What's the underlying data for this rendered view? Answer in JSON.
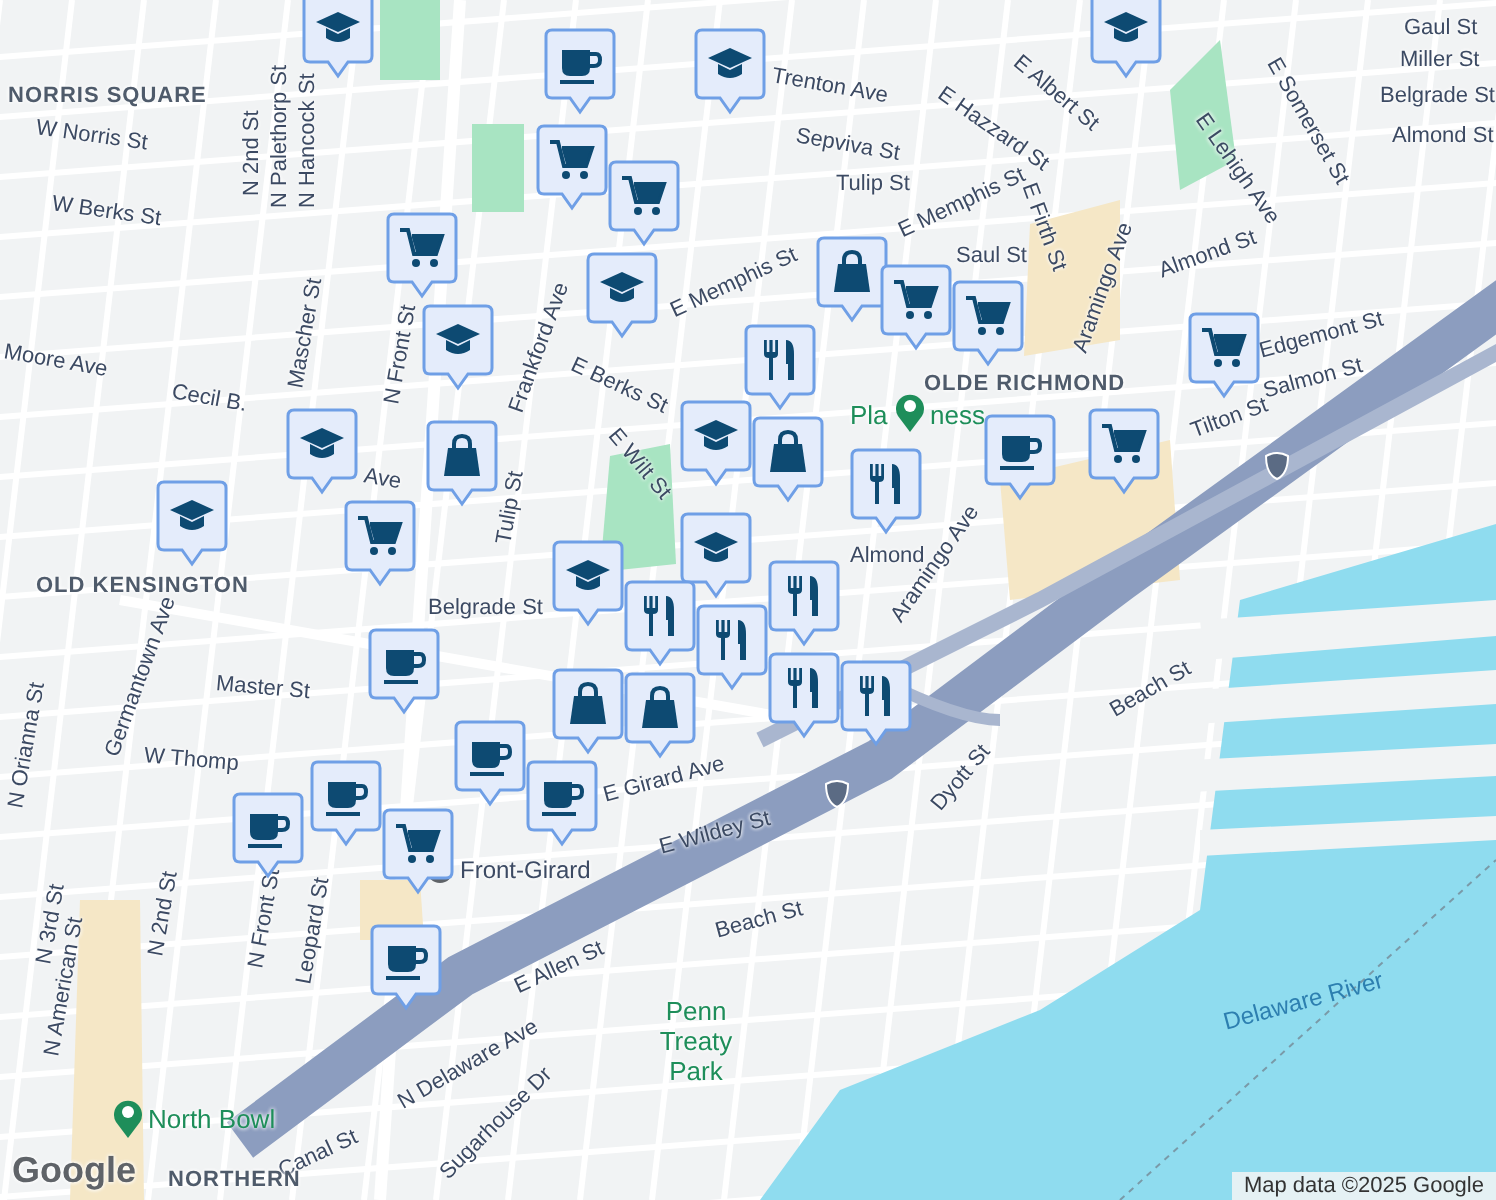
{
  "map": {
    "labels": [
      {
        "kind": "area",
        "text": "NORRIS SQUARE"
      },
      {
        "kind": "street",
        "text": "W Norris St"
      },
      {
        "kind": "street",
        "text": "W Berks St"
      },
      {
        "kind": "street",
        "text": "N 2nd St"
      },
      {
        "kind": "street",
        "text": "N Palethorp St"
      },
      {
        "kind": "street",
        "text": "N Hancock St"
      },
      {
        "kind": "street",
        "text": "Moore Ave"
      },
      {
        "kind": "street",
        "text": "Cecil B."
      },
      {
        "kind": "street",
        "text": "Ave"
      },
      {
        "kind": "street",
        "text": "Mascher St"
      },
      {
        "kind": "street",
        "text": "N Front St"
      },
      {
        "kind": "street",
        "text": "Frankford Ave"
      },
      {
        "kind": "street",
        "text": "Tulip St"
      },
      {
        "kind": "street",
        "text": "E Berks St"
      },
      {
        "kind": "street",
        "text": "E Wilt St"
      },
      {
        "kind": "street",
        "text": "E Memphis St"
      },
      {
        "kind": "street",
        "text": "Trenton Ave"
      },
      {
        "kind": "street",
        "text": "Sepviva St"
      },
      {
        "kind": "street",
        "text": "Tulip St"
      },
      {
        "kind": "street",
        "text": "E Memphis St"
      },
      {
        "kind": "street",
        "text": "E Hazzard St"
      },
      {
        "kind": "street",
        "text": "E Firth St"
      },
      {
        "kind": "street",
        "text": "E Albert St"
      },
      {
        "kind": "street",
        "text": "Saul St"
      },
      {
        "kind": "street",
        "text": "Almond St"
      },
      {
        "kind": "street",
        "text": "E Lehigh Ave"
      },
      {
        "kind": "street",
        "text": "E Somerset St"
      },
      {
        "kind": "street",
        "text": "Gaul St"
      },
      {
        "kind": "street",
        "text": "Miller St"
      },
      {
        "kind": "street",
        "text": "Belgrade St"
      },
      {
        "kind": "street",
        "text": "Almond St"
      },
      {
        "kind": "street",
        "text": "Aramingo Ave"
      },
      {
        "kind": "street",
        "text": "Edgemont St"
      },
      {
        "kind": "street",
        "text": "Salmon St"
      },
      {
        "kind": "street",
        "text": "Tilton St"
      },
      {
        "kind": "street",
        "text": "Almond"
      },
      {
        "kind": "area",
        "text": "OLDE RICHMOND"
      },
      {
        "kind": "place",
        "text": "Pla"
      },
      {
        "kind": "place",
        "text": "ness"
      },
      {
        "kind": "area",
        "text": "OLD KENSINGTON"
      },
      {
        "kind": "street",
        "text": "Aramingo Ave"
      },
      {
        "kind": "street",
        "text": "Belgrade St"
      },
      {
        "kind": "street",
        "text": "Master St"
      },
      {
        "kind": "street",
        "text": "W Thomp"
      },
      {
        "kind": "street",
        "text": "Germantown Ave"
      },
      {
        "kind": "street",
        "text": "N Orianna St"
      },
      {
        "kind": "street",
        "text": "E Girard Ave"
      },
      {
        "kind": "street",
        "text": "E Wildey St"
      },
      {
        "kind": "street",
        "text": "Beach St"
      },
      {
        "kind": "street",
        "text": "Dyott St"
      },
      {
        "kind": "station",
        "text": "Front-Girard"
      },
      {
        "kind": "street",
        "text": "N Front St"
      },
      {
        "kind": "street",
        "text": "Leopard St"
      },
      {
        "kind": "street",
        "text": "N 2nd St"
      },
      {
        "kind": "street",
        "text": "N 3rd St"
      },
      {
        "kind": "street",
        "text": "N American St"
      },
      {
        "kind": "street",
        "text": "Beach St"
      },
      {
        "kind": "street",
        "text": "E Allen St"
      },
      {
        "kind": "park",
        "text": "Penn Treaty Park"
      },
      {
        "kind": "water",
        "text": "Delaware River"
      },
      {
        "kind": "street",
        "text": "N Delaware Ave"
      },
      {
        "kind": "street",
        "text": "Sugarhouse Dr"
      },
      {
        "kind": "street",
        "text": "Canal St"
      },
      {
        "kind": "place",
        "text": "North Bowl"
      },
      {
        "kind": "area",
        "text": "NORTHERN"
      }
    ],
    "markers": [
      {
        "kind": "school"
      },
      {
        "kind": "school"
      },
      {
        "kind": "coffee"
      },
      {
        "kind": "school"
      },
      {
        "kind": "cart"
      },
      {
        "kind": "cart"
      },
      {
        "kind": "cart"
      },
      {
        "kind": "school"
      },
      {
        "kind": "bag"
      },
      {
        "kind": "cart"
      },
      {
        "kind": "cart"
      },
      {
        "kind": "school"
      },
      {
        "kind": "restaurant"
      },
      {
        "kind": "school"
      },
      {
        "kind": "bag"
      },
      {
        "kind": "restaurant"
      },
      {
        "kind": "coffee"
      },
      {
        "kind": "cart"
      },
      {
        "kind": "cart"
      },
      {
        "kind": "school"
      },
      {
        "kind": "bag"
      },
      {
        "kind": "cart"
      },
      {
        "kind": "school"
      },
      {
        "kind": "school"
      },
      {
        "kind": "school"
      },
      {
        "kind": "restaurant"
      },
      {
        "kind": "restaurant"
      },
      {
        "kind": "restaurant"
      },
      {
        "kind": "restaurant"
      },
      {
        "kind": "bag"
      },
      {
        "kind": "bag"
      },
      {
        "kind": "coffee"
      },
      {
        "kind": "coffee"
      },
      {
        "kind": "coffee"
      },
      {
        "kind": "coffee"
      },
      {
        "kind": "cart"
      },
      {
        "kind": "coffee"
      },
      {
        "kind": "coffee"
      },
      {
        "kind": "restaurant"
      }
    ],
    "logo": "Google",
    "attribution": "Map data ©2025 Google"
  }
}
